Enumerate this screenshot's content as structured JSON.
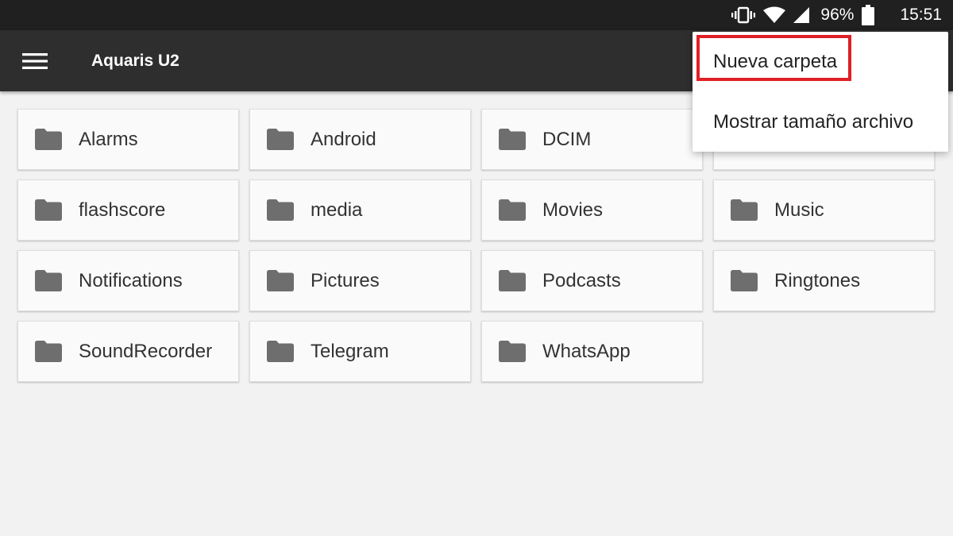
{
  "status_bar": {
    "battery_percent": "96%",
    "clock": "15:51",
    "icons": [
      "vibrate-icon",
      "wifi-icon",
      "signal-icon",
      "battery-icon"
    ]
  },
  "app_bar": {
    "title": "Aquaris U2",
    "menu_icon": "hamburger-menu-icon"
  },
  "folders": [
    {
      "name": "Alarms"
    },
    {
      "name": "Android"
    },
    {
      "name": "DCIM"
    },
    {
      "name": ""
    },
    {
      "name": "flashscore"
    },
    {
      "name": "media"
    },
    {
      "name": "Movies"
    },
    {
      "name": "Music"
    },
    {
      "name": "Notifications"
    },
    {
      "name": "Pictures"
    },
    {
      "name": "Podcasts"
    },
    {
      "name": "Ringtones"
    },
    {
      "name": "SoundRecorder"
    },
    {
      "name": "Telegram"
    },
    {
      "name": "WhatsApp"
    }
  ],
  "overflow_menu": {
    "items": [
      {
        "label": "Nueva carpeta",
        "highlighted": true
      },
      {
        "label": "Mostrar tamaño archivo",
        "highlighted": false
      }
    ]
  },
  "colors": {
    "status_bar_bg": "#202020",
    "app_bar_bg": "#2e2e2e",
    "page_bg": "#f2f2f2",
    "tile_bg": "#fafafa",
    "folder_icon": "#6e6e6e",
    "highlight": "#e01f26"
  }
}
